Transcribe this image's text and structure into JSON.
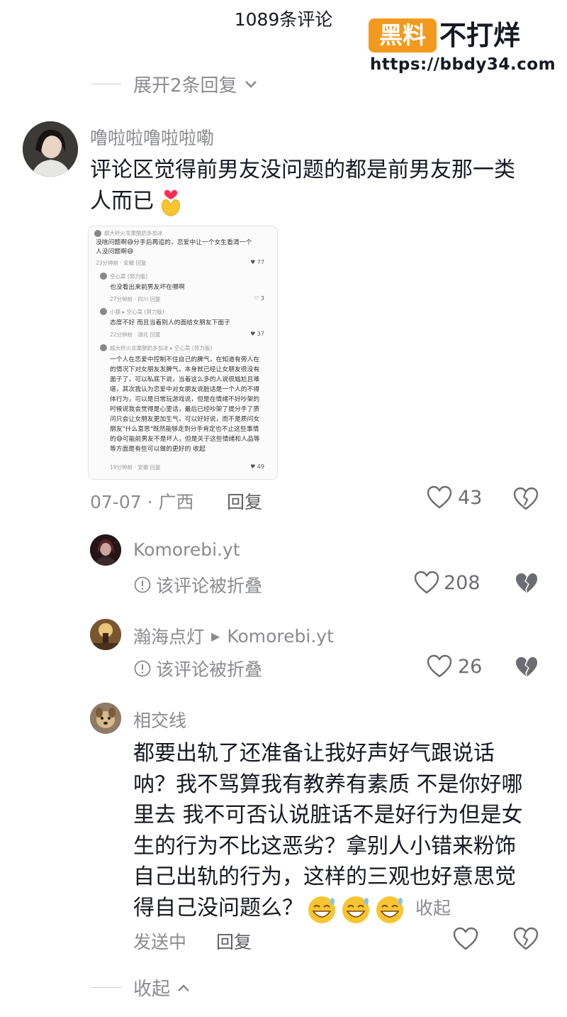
{
  "header": {
    "title": "1089条评论"
  },
  "watermark": {
    "badge": "黑料",
    "brand": "不打烊",
    "url": "https://bbdy34.com"
  },
  "expand_top": {
    "label": "展开2条回复"
  },
  "comment_main": {
    "author": "噜啦啦噜啦啦嘞",
    "text_line1": "评论区觉得前男友没问题的都是前男友那一类",
    "text_line2": "人而已",
    "date": "07-07 · 广西",
    "reply": "回复",
    "likes": "43",
    "emoji_icon": "heart-hands-icon"
  },
  "screenshot": {
    "l1_name": "超大杯火龙果酸奶多加冰",
    "l1a": "没啥问题啊😅分手后再追的，恋爱中让一个女生看清一个",
    "l1b": "人没问题啊😅",
    "l1_meta": "23分钟前 · 安徽    回复",
    "l1_likes": "♥ 77",
    "l2_name": "空心菜 (努力版)",
    "l2a": "也没看出来前男友坏在哪啊",
    "l2_meta": "27分钟前 · 四川    回复",
    "l2_likes": "♡ 3",
    "l3_name": "小猫 ▸ 空心菜 (努力版)",
    "l3a": "态度不好 而且当着别人的面给女朋友下面子",
    "l3_meta": "22分钟前 · 湖北    回复",
    "l3_likes": "♥ 37",
    "l4_name": "超大杯火龙果酸奶多加冰 ▸ 空心菜 (努力版)",
    "p1": "一个人在恋爱中控制不住自己的脾气，在知道有旁人在",
    "p2": "的情况下对女朋友发脾气，本身就已经让女朋友很没有",
    "p3": "面子了，可以私底下说，当着这么多的人说很尴尬且难",
    "p4": "堪，其次我认为恋爱中对女朋友说脏话是一个人的不得",
    "p5": "体行为，可以是日常玩游戏说，但是在情绪不好吵架的",
    "p6": "时候说我会觉得是心里话，最后已经吵架了提分手了质",
    "p7": "问只会让女朋友更加生气，可以好好说，而不是质问女",
    "p8": "朋友\"什么意思\"既然能够走到分手肯定也不止这些事情",
    "p9": "的😅可能前男友不是坏人，但是关于这些情绪和人品等",
    "p10": "等方面是有些可以做的更好的  收起",
    "l4_meta": "19分钟前 · 安徽    回复",
    "l4_likes": "♥ 49"
  },
  "reply1": {
    "author": "Komorebi.yt",
    "folded": "该评论被折叠",
    "likes": "208"
  },
  "reply2": {
    "author": "瀚海点灯",
    "arrow": "▶",
    "target": "Komorebi.yt",
    "folded": "该评论被折叠",
    "likes": "26"
  },
  "reply3": {
    "author": "相交线",
    "lines": [
      "都要出轨了还准备让我好声好气跟说话",
      "呐？我不骂算我有教养有素质 不是你好哪",
      "里去 我不可否认说脏话不是好行为但是女",
      "生的行为不比这恶劣？拿别人小错来粉饰",
      "自己出轨的行为，这样的三观也好意思觉",
      "得自己没问题么？"
    ],
    "collapse_inline": "收起",
    "status": "发送中",
    "reply": "回复"
  },
  "collapse_bottom": {
    "label": "收起"
  },
  "colors": {
    "accent_orange": "#f39a1e",
    "like_red": "#fe2c55",
    "text": "#161823",
    "grey": "#8a8b91"
  }
}
